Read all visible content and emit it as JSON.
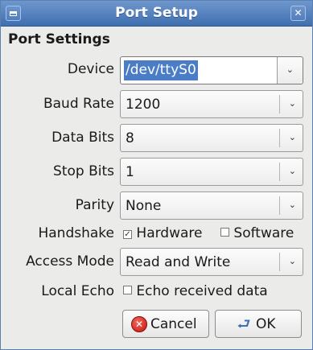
{
  "window": {
    "title": "Port Setup",
    "menu_icon": "window-menu-icon",
    "close_icon": "close-icon",
    "close_glyph": "✕"
  },
  "section": {
    "title": "Port Settings"
  },
  "fields": {
    "device": {
      "label": "Device",
      "value": "/dev/ttyS0"
    },
    "baud_rate": {
      "label": "Baud Rate",
      "value": "1200"
    },
    "data_bits": {
      "label": "Data Bits",
      "value": "8"
    },
    "stop_bits": {
      "label": "Stop Bits",
      "value": "1"
    },
    "parity": {
      "label": "Parity",
      "value": "None"
    },
    "handshake": {
      "label": "Handshake",
      "hardware_label": "Hardware",
      "hardware_checked": true,
      "software_label": "Software",
      "software_checked": false
    },
    "access_mode": {
      "label": "Access Mode",
      "value": "Read and Write"
    },
    "local_echo": {
      "label": "Local Echo",
      "option_label": "Echo received data",
      "checked": false
    }
  },
  "glyphs": {
    "dropdown_arrow": "⌄",
    "check_on": "✓",
    "check_off": ""
  },
  "buttons": {
    "cancel": {
      "label": "Cancel",
      "mnemonic": "C",
      "icon": "cancel-icon",
      "icon_glyph": "✕"
    },
    "ok": {
      "label": "OK",
      "mnemonic": "O",
      "icon": "ok-arrow-icon",
      "icon_glyph": "⮐"
    }
  },
  "colors": {
    "titlebar": "#4f7fc0",
    "selection": "#4a7dc6",
    "cancel_red": "#d21f13"
  }
}
